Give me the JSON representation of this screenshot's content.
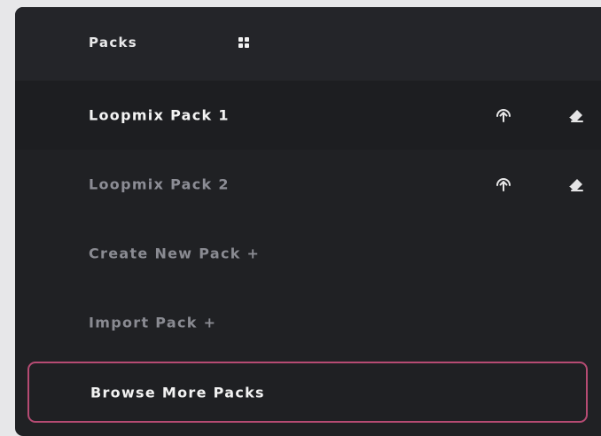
{
  "header": {
    "title": "Packs",
    "icon": "grid-icon"
  },
  "packs": [
    {
      "label": "Loopmix Pack 1",
      "icons": [
        "upload-icon",
        "eraser-icon"
      ]
    },
    {
      "label": "Loopmix Pack 2",
      "icons": [
        "upload-icon",
        "eraser-icon"
      ]
    }
  ],
  "actions": {
    "create": "Create New Pack +",
    "import": "Import Pack +",
    "browse": "Browse More Packs"
  },
  "colors": {
    "panel_bg": "#202124",
    "header_bg": "#242529",
    "accent_border": "#b64b73",
    "active_text": "#f4f4f4",
    "muted_text": "#8c8d95"
  }
}
